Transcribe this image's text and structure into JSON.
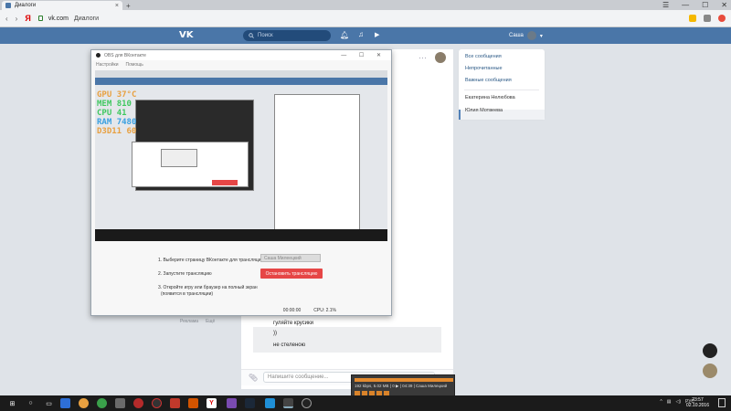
{
  "browser": {
    "tab_title": "Диалоги",
    "new_tab": "+",
    "tab_close": "×",
    "window_controls": [
      "☰",
      "—",
      "☐",
      "✕"
    ],
    "nav_back": "‹",
    "nav_forward": "›",
    "yandex_logo": "Я",
    "host": "vk.com",
    "page_title": "Диалоги",
    "toolbar_icons": [
      "star-icon",
      "extensions-icon",
      "download-icon"
    ]
  },
  "vk": {
    "logo": "VK",
    "search_placeholder": "Поиск",
    "username": "Саша",
    "header_icons": [
      "bell-icon",
      "music-icon",
      "play-icon"
    ]
  },
  "right_menu": {
    "items": [
      "Все сообщения",
      "Непрочитанные",
      "Важные сообщения",
      "Екатерина Нелюбова",
      "Юлия Мотвеева"
    ],
    "selected_index": 4
  },
  "chat": {
    "messages": [
      "гуляйте крусики",
      "))",
      "не стеленою"
    ],
    "input_placeholder": "Напишите сообщение...",
    "left_links": [
      "Реклама",
      "Ещё"
    ]
  },
  "obs": {
    "title": "OBS для ВКонтакте",
    "menu": [
      "Настройки",
      "Помощь"
    ],
    "window_controls": "— ☐ ✕",
    "overlay_stats": [
      {
        "label": "GPU",
        "value": "37°C",
        "color": "#e8a040"
      },
      {
        "label": "MEM",
        "value": "810",
        "color": "#40c860"
      },
      {
        "label": "CPU",
        "value": "41",
        "color": "#40c860"
      },
      {
        "label": "RAM",
        "value": "7480",
        "color": "#3aa0e0"
      },
      {
        "label": "D3D11",
        "value": "60",
        "color": "#e8a040"
      }
    ],
    "step1": "1. Выберите страницу ВКонтакте для трансляции",
    "channel_value": "Саша Милеецкий",
    "step2": "2. Запустите трансляцию",
    "stop_button": "Остановить трансляцию",
    "step3_line1": "3. Откройте игру или браузер на полный экран",
    "step3_line2": "(появится в трансляции)",
    "status_time": "00:00:00",
    "status_cpu": "CPU: 2.1%"
  },
  "player": {
    "text": "192 kbps, 5.02 MB | 0 ▶ | 04:39 | Саша Милецкий",
    "progress": 1.0
  },
  "taskbar": {
    "tray_lang": "РУС",
    "time": "23:57",
    "date": "02.10.2016"
  }
}
